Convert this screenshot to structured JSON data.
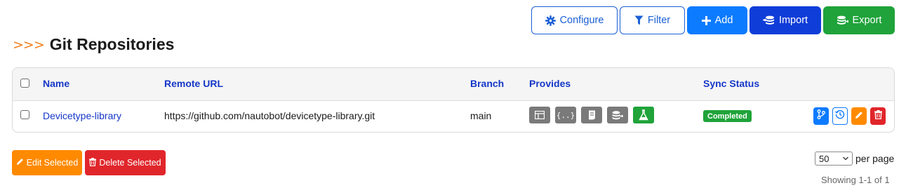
{
  "toolbar": {
    "configure_label": "Configure",
    "filter_label": "Filter",
    "add_label": "Add",
    "import_label": "Import",
    "export_label": "Export"
  },
  "page": {
    "chevrons": ">>>",
    "title": "Git Repositories"
  },
  "table": {
    "columns": {
      "name": "Name",
      "remote_url": "Remote URL",
      "branch": "Branch",
      "provides": "Provides",
      "sync_status": "Sync Status"
    },
    "rows": [
      {
        "name": "Devicetype-library",
        "remote_url": "https://github.com/nautobot/devicetype-library.git",
        "branch": "main",
        "provides": [
          "export-templates-icon",
          "config-context-schemas-icon",
          "jobs-icon",
          "config-contexts-icon",
          "device-types-icon"
        ],
        "sync_status": "Completed"
      }
    ]
  },
  "bulk": {
    "edit_label": "Edit Selected",
    "delete_label": "Delete Selected"
  },
  "pagination": {
    "per_page_value": "50",
    "per_page_label": "per page",
    "showing": "Showing 1-1 of 1"
  },
  "colors": {
    "accent_blue": "#0d7bff",
    "import_blue": "#0f3dd8",
    "success_green": "#1fa33a",
    "warning_orange": "#ff8a00",
    "danger_red": "#e0262b",
    "link_blue": "#1537c8"
  }
}
